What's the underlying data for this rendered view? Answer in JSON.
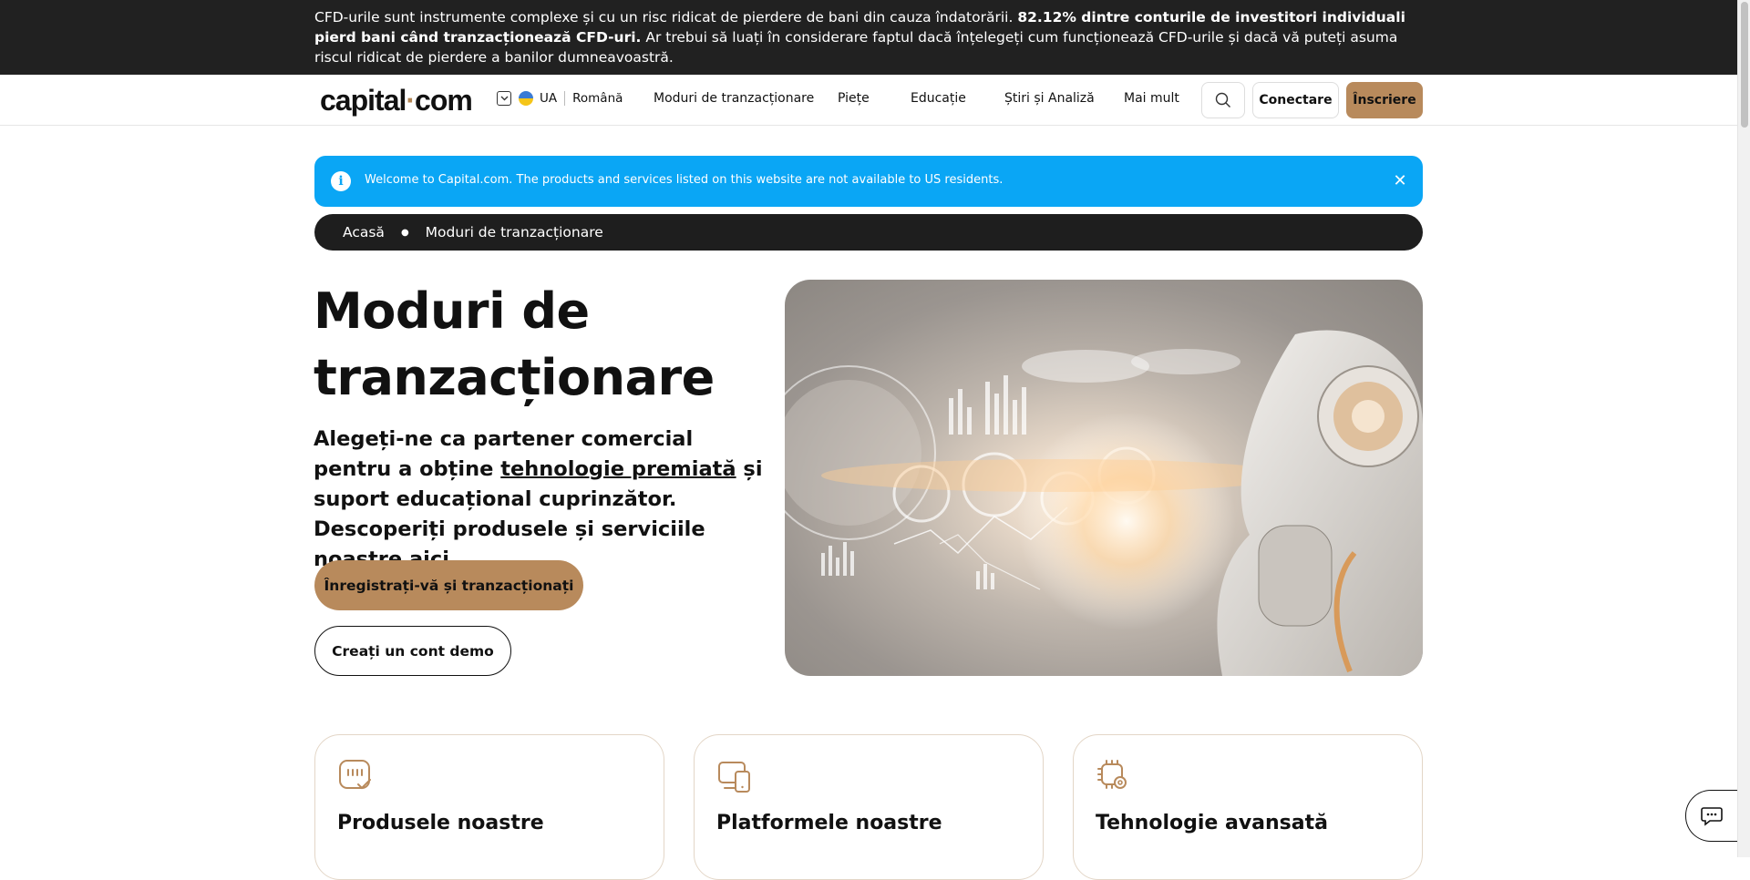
{
  "risk_banner": {
    "text_start": "CFD-urile sunt instrumente complexe și cu un risc ridicat de pierdere de bani din cauza îndatorării. ",
    "text_bold": "82.12% dintre conturile de investitori individuali pierd bani când tranzacționează CFD-uri.",
    "text_end": " Ar trebui să luați în considerare faptul dacă înțelegeți cum funcționează CFD-urile și dacă vă puteți asuma riscul ridicat de pierdere a banilor dumneavoastră."
  },
  "header": {
    "logo_left": "capital",
    "logo_dot": "·",
    "logo_right": "com",
    "region": "UA",
    "language": "Română",
    "nav": [
      "Moduri de tranzacționare",
      "Piețe",
      "Educație",
      "Știri și Analiză",
      "Mai mult"
    ],
    "login_label": "Conectare",
    "signup_label": "Înscriere"
  },
  "notice": {
    "message": "Welcome to Capital.com. The products and services listed on this website are not available to US residents.",
    "close": "✕"
  },
  "breadcrumb": {
    "items": [
      "Acasă",
      "Moduri de tranzacționare"
    ]
  },
  "hero": {
    "title_line1": "Moduri de",
    "title_line2": "tranzacționare",
    "subtitle_before": "Alegeți-ne ca partener comercial pentru a obține ",
    "subtitle_link": "tehnologie premiată",
    "subtitle_after": " și suport educațional cuprinzător. Descoperiți produsele și serviciile noastre aici",
    "cta_primary": "Înregistrați-vă și tranzacționați",
    "cta_secondary": "Creați un cont demo"
  },
  "cards": [
    {
      "title": "Produsele noastre",
      "icon": "chat-check-icon"
    },
    {
      "title": "Platformele noastre",
      "icon": "devices-icon"
    },
    {
      "title": "Tehnologie avansată",
      "icon": "chip-gear-icon"
    }
  ],
  "colors": {
    "accent": "#b88a5c",
    "notice": "#0aa6f5",
    "banner": "#212121"
  }
}
